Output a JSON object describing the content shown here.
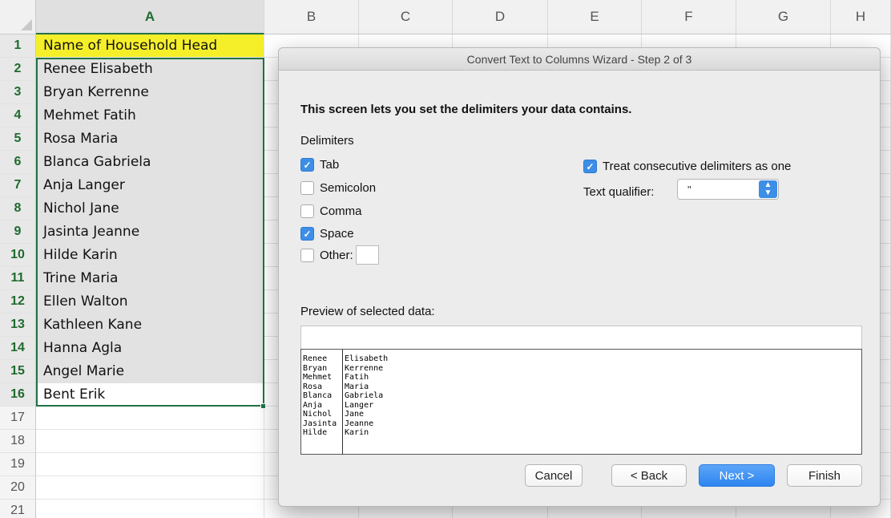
{
  "sheet": {
    "columns": [
      "A",
      "B",
      "C",
      "D",
      "E",
      "F",
      "G",
      "H"
    ],
    "rows": [
      "1",
      "2",
      "3",
      "4",
      "5",
      "6",
      "7",
      "8",
      "9",
      "10",
      "11",
      "12",
      "13",
      "14",
      "15",
      "16",
      "17",
      "18",
      "19",
      "20",
      "21"
    ],
    "cells_a": [
      "Name of Household Head",
      "Renee Elisabeth",
      "Bryan Kerrenne",
      "Mehmet Fatih",
      "Rosa Maria",
      "Blanca Gabriela",
      "Anja Langer",
      "Nichol Jane",
      "Jasinta Jeanne",
      "Hilde Karin",
      "Trine Maria",
      "Ellen Walton",
      "Kathleen Kane",
      "Hanna Agla",
      "Angel Marie",
      "Bent Erik",
      "",
      "",
      "",
      "",
      ""
    ]
  },
  "dialog": {
    "title": "Convert Text to Columns Wizard - Step 2 of 3",
    "instruction": "This screen lets you set the delimiters your data contains.",
    "delimiters_label": "Delimiters",
    "checkboxes": {
      "tab": {
        "label": "Tab",
        "checked": true
      },
      "semicolon": {
        "label": "Semicolon",
        "checked": false
      },
      "comma": {
        "label": "Comma",
        "checked": false
      },
      "space": {
        "label": "Space",
        "checked": true
      },
      "other": {
        "label": "Other:",
        "checked": false
      },
      "consecutive": {
        "label": "Treat consecutive delimiters as one",
        "checked": true
      }
    },
    "text_qualifier_label": "Text qualifier:",
    "text_qualifier_value": "\"",
    "preview_label": "Preview of selected data:",
    "preview_rows": [
      [
        "Renee",
        "Elisabeth"
      ],
      [
        "Bryan",
        "Kerrenne"
      ],
      [
        "Mehmet",
        "Fatih"
      ],
      [
        "Rosa",
        "Maria"
      ],
      [
        "Blanca",
        "Gabriela"
      ],
      [
        "Anja",
        "Langer"
      ],
      [
        "Nichol",
        "Jane"
      ],
      [
        "Jasinta",
        "Jeanne"
      ],
      [
        "Hilde",
        "Karin"
      ]
    ],
    "buttons": {
      "cancel": "Cancel",
      "back": "< Back",
      "next": "Next >",
      "finish": "Finish"
    }
  },
  "colors": {
    "selection_border": "#217346",
    "header_highlight": "#f5ef2a",
    "accent_blue": "#3d8ee6"
  }
}
